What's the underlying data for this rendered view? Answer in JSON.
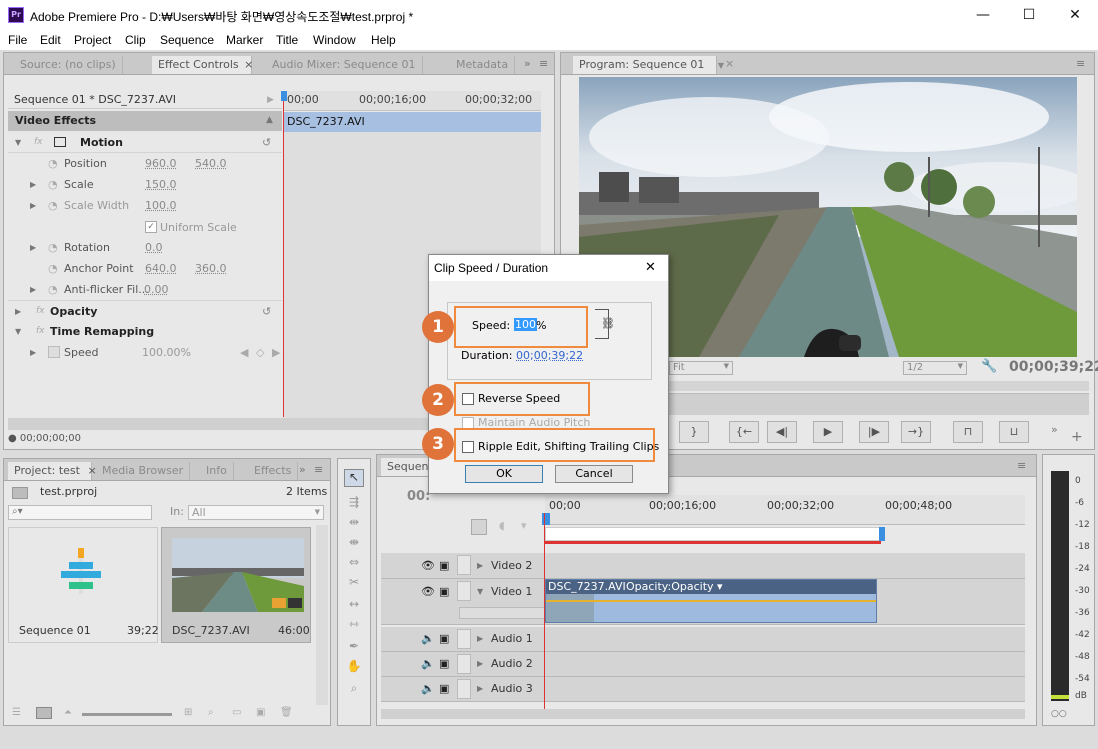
{
  "window": {
    "title": "Adobe Premiere Pro - D:₩Users₩바탕 화면₩영상속도조절₩test.prproj *",
    "app_icon": "Pr",
    "controls": {
      "minimize": "—",
      "maximize": "☐",
      "close": "✕"
    }
  },
  "menu": [
    "File",
    "Edit",
    "Project",
    "Clip",
    "Sequence",
    "Marker",
    "Title",
    "Window",
    "Help"
  ],
  "source_panel": {
    "tabs": [
      "Source: (no clips)",
      "Effect Controls",
      "Audio Mixer: Sequence 01",
      "Metadata"
    ],
    "active_tab": "Effect Controls",
    "tab_close": "×",
    "sequence_label": "Sequence 01 * DSC_7237.AVI",
    "ruler": [
      "00;00",
      "00;00;16;00",
      "00;00;32;00"
    ],
    "clip_name": "DSC_7237.AVI",
    "video_effects": "Video Effects",
    "motion": "Motion",
    "properties": [
      {
        "name": "Position",
        "v1": "960.0",
        "v2": "540.0"
      },
      {
        "name": "Scale",
        "v1": "150.0",
        "v2": ""
      },
      {
        "name": "Scale Width",
        "v1": "100.0",
        "v2": ""
      },
      {
        "name": "Uniform Scale",
        "v1": "",
        "v2": ""
      },
      {
        "name": "Rotation",
        "v1": "0.0",
        "v2": ""
      },
      {
        "name": "Anchor Point",
        "v1": "640.0",
        "v2": "360.0"
      },
      {
        "name": "Anti-flicker Fil...",
        "v1": "0.00",
        "v2": ""
      }
    ],
    "opacity": "Opacity",
    "time_remapping": "Time Remapping",
    "speed": {
      "name": "Speed",
      "value": "100.00%"
    },
    "timecode": "00;00;00;00"
  },
  "program_panel": {
    "tab": "Program: Sequence 01",
    "fit": "Fit",
    "res": "1/2",
    "timecode": "00;00;39;22"
  },
  "project_panel": {
    "tabs": [
      "Project: test",
      "Media Browser",
      "Info",
      "Effects"
    ],
    "file": "test.prproj",
    "count": "2 Items",
    "in_label": "In:",
    "in_value": "All",
    "items": [
      {
        "name": "Sequence 01",
        "duration": "39;22"
      },
      {
        "name": "DSC_7237.AVI",
        "duration": "46:00"
      }
    ]
  },
  "timeline_panel": {
    "tab": "Sequence 01",
    "timecode": "00:",
    "ruler": [
      "00;00",
      "00;00;16;00",
      "00;00;32;00",
      "00;00;48;00"
    ],
    "tracks": {
      "video": [
        "Video 2",
        "Video 1"
      ],
      "audio": [
        "Audio 1",
        "Audio 2",
        "Audio 3"
      ]
    },
    "clip_label": "DSC_7237.AVI",
    "clip_effect": "Opacity:Opacity ▾"
  },
  "meter": {
    "labels": [
      "0",
      "-6",
      "-12",
      "-18",
      "-24",
      "-30",
      "-36",
      "-42",
      "-48",
      "-54",
      "dB"
    ]
  },
  "dialog": {
    "title": "Clip Speed / Duration",
    "close": "✕",
    "speed_label": "Speed:",
    "speed_value": "100",
    "speed_unit": "%",
    "duration_label": "Duration:",
    "duration_value": "00;00;39;22",
    "reverse_speed": "Reverse Speed",
    "maintain_audio_pitch": "Maintain Audio Pitch",
    "ripple_edit": "Ripple Edit, Shifting Trailing Clips",
    "ok": "OK",
    "cancel": "Cancel"
  },
  "annotations": [
    "1",
    "2",
    "3"
  ],
  "colors": {
    "accent": "#f08a3c",
    "badge": "#e0733a",
    "selection": "#3399ff",
    "clip_blue": "#9ebadf",
    "playhead": "#d33"
  }
}
